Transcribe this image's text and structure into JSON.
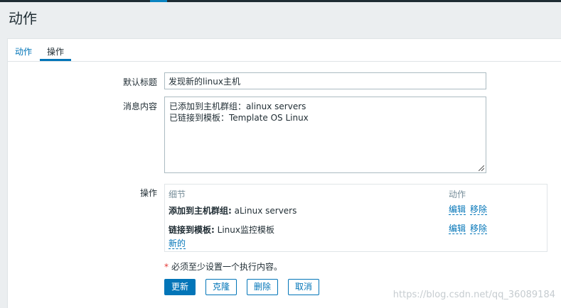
{
  "page": {
    "title": "动作"
  },
  "tabs": [
    {
      "label": "动作",
      "active": false
    },
    {
      "label": "操作",
      "active": true
    }
  ],
  "form": {
    "default_subject_label": "默认标题",
    "default_subject_value": "发现新的linux主机",
    "message_label": "消息内容",
    "message_value": "已添加到主机群组：alinux servers\n已链接到模板：Template OS Linux",
    "operations_label": "操作"
  },
  "operations": {
    "header_details": "细节",
    "header_action": "动作",
    "rows": [
      {
        "prefix": "添加到主机群组:",
        "value": " aLinux servers",
        "edit": "编辑",
        "remove": "移除"
      },
      {
        "prefix": "链接到模板:",
        "value": " Linux监控模板",
        "edit": "编辑",
        "remove": "移除"
      }
    ],
    "new_link": "新的"
  },
  "required_note": "必须至少设置一个执行内容。",
  "buttons": {
    "update": "更新",
    "clone": "克隆",
    "delete": "删除",
    "cancel": "取消"
  },
  "watermark": "https://blog.csdn.net/qq_36089184",
  "colors": {
    "accent": "#0275b8",
    "required": "#e33734",
    "background": "#ebeef0"
  }
}
